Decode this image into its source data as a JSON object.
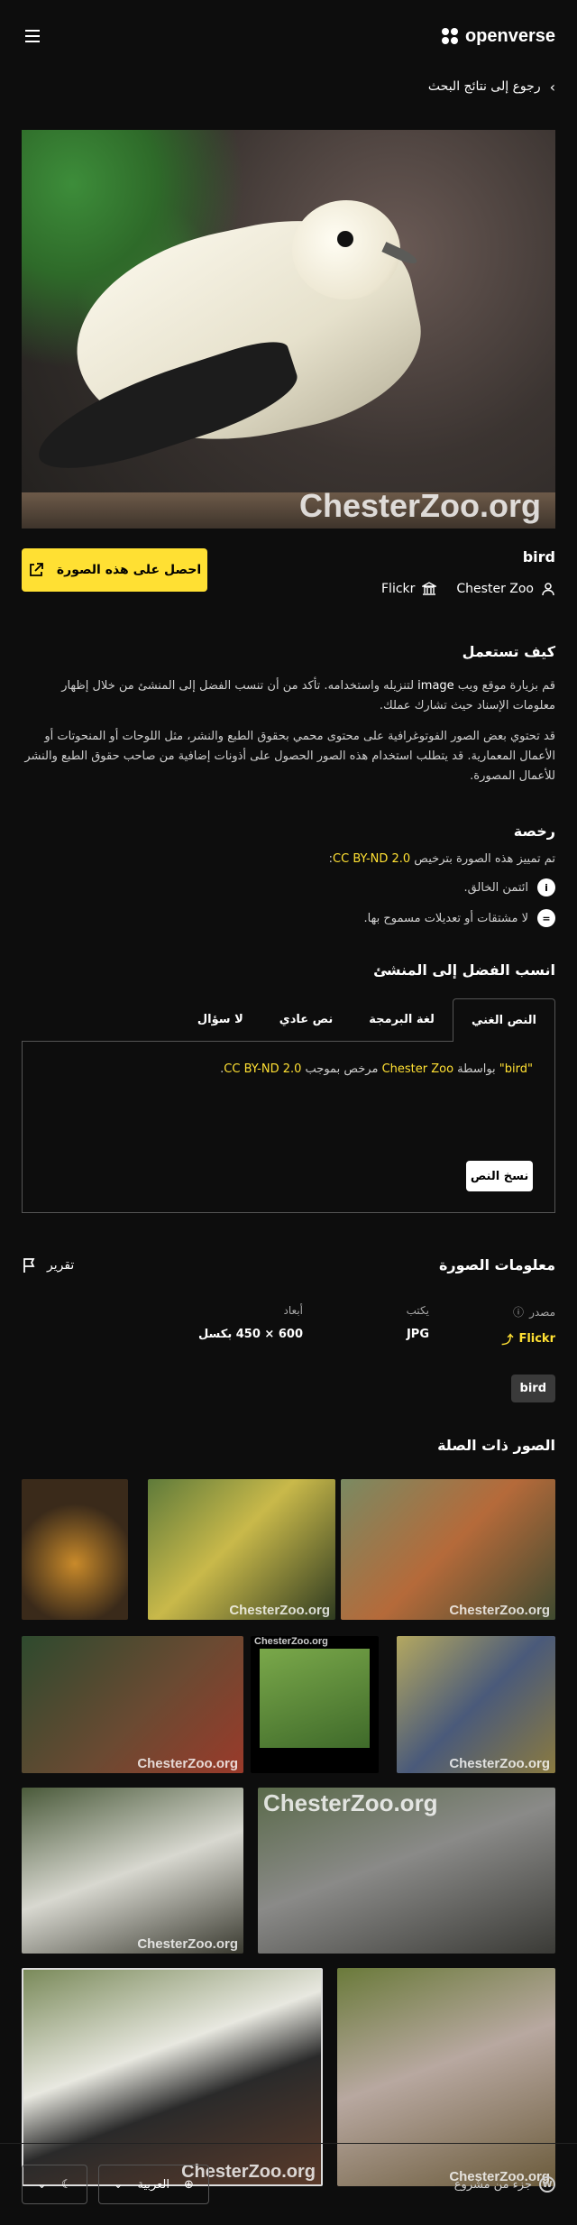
{
  "header": {
    "logo_text": "openverse",
    "menu_icon": "menu-icon"
  },
  "nav": {
    "back_label": "رجوع إلى نتائج البحث"
  },
  "image": {
    "title": "bird",
    "watermark": "ChesterZoo.org"
  },
  "creator": {
    "source": "Flickr",
    "name": "Chester Zoo"
  },
  "actions": {
    "get_image": "احصل على هذه الصورة"
  },
  "how_to_use": {
    "heading": "كيف تستعمل",
    "p1_before": "قم بزيارة موقع ويب ",
    "p1_highlight": "image",
    "p1_after": " لتنزيله واستخدامه. تأكد من أن تنسب الفضل إلى المنشئ من خلال إظهار معلومات الإسناد حيث تشارك عملك.",
    "p2": "قد تحتوي بعض الصور الفوتوغرافية على محتوى محمي بحقوق الطبع والنشر، مثل اللوحات أو المنحوتات أو الأعمال المعمارية. قد يتطلب استخدام هذه الصور الحصول على أذونات إضافية من صاحب حقوق الطبع والنشر للأعمال المصورة."
  },
  "license": {
    "heading": "رخصة",
    "intro": "تم تمييز هذه الصورة بترخيص ",
    "name": "CC BY-ND 2.0",
    "suffix": ":",
    "items": [
      {
        "label": "ائتمن الخالق.",
        "icon": "person-icon"
      },
      {
        "label": "لا مشتقات أو تعديلات مسموح بها.",
        "icon": "equal-icon"
      }
    ]
  },
  "attribution": {
    "heading": "انسب الفضل إلى المنشئ",
    "tabs": [
      "النص الغني",
      "لغة البرمجة",
      "نص عادي",
      "لا سؤال"
    ],
    "text_title": "\"bird\"",
    "text_by": " بواسطة ",
    "text_author": "Chester Zoo",
    "text_licensed": " مرخص بموجب ",
    "text_license": "CC BY-ND 2.0",
    "text_end": ".",
    "copy_label": "نسخ النص"
  },
  "info": {
    "heading": "معلومات الصورة",
    "report_label": "تقرير",
    "source_label": "مصدر",
    "source_value": "Flickr",
    "type_label": "يكتب",
    "type_value": "JPG",
    "dims_label": "أبعاد",
    "dims_value": "600 × 450 بكسل",
    "tag": "bird"
  },
  "related": {
    "heading": "الصور ذات الصلة",
    "watermark": "ChesterZoo.org"
  },
  "footer": {
    "made_by": "جزء من مشروع",
    "language": "العربية",
    "theme_icon": "moon-icon"
  },
  "colors": {
    "accent": "#ffe033",
    "background": "#0d0d0d"
  }
}
